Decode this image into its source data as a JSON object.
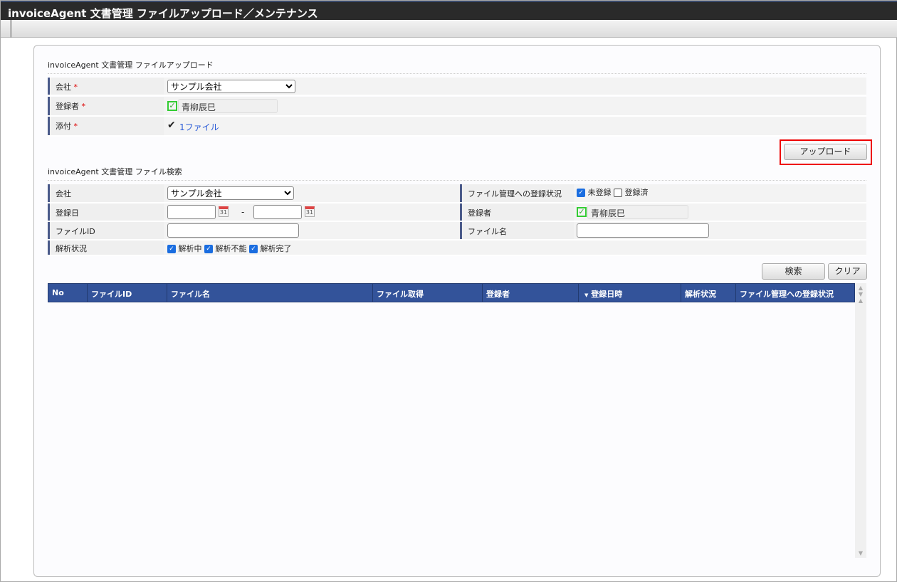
{
  "title": "invoiceAgent 文書管理 ファイルアップロード／メンテナンス",
  "upload": {
    "section_title": "invoiceAgent 文書管理 ファイルアップロード",
    "company_label": "会社",
    "company_value": "サンプル会社",
    "registrant_label": "登録者",
    "registrant_value": "青柳辰巳",
    "attach_label": "添付",
    "attach_value": "1ファイル",
    "required_mark": "*",
    "upload_button": "アップロード"
  },
  "search": {
    "section_title": "invoiceAgent 文書管理 ファイル検索",
    "company_label": "会社",
    "company_value": "サンプル会社",
    "date_label": "登録日",
    "date_sep": "-",
    "calendar_text": "31",
    "fileid_label": "ファイルID",
    "status_label": "解析状況",
    "status_options": [
      {
        "label": "解析中",
        "checked": true
      },
      {
        "label": "解析不能",
        "checked": true
      },
      {
        "label": "解析完了",
        "checked": true
      }
    ],
    "reg_status_label": "ファイル管理への登録状況",
    "reg_options": [
      {
        "label": "未登録",
        "checked": true
      },
      {
        "label": "登録済",
        "checked": false
      }
    ],
    "registrant_label": "登録者",
    "registrant_value": "青柳辰巳",
    "filename_label": "ファイル名",
    "search_button": "検索",
    "clear_button": "クリア"
  },
  "table": {
    "columns": [
      "No",
      "ファイルID",
      "ファイル名",
      "ファイル取得",
      "登録者",
      "登録日時",
      "解析状況",
      "ファイル管理への登録状況"
    ],
    "sort_indicator": "▼"
  }
}
